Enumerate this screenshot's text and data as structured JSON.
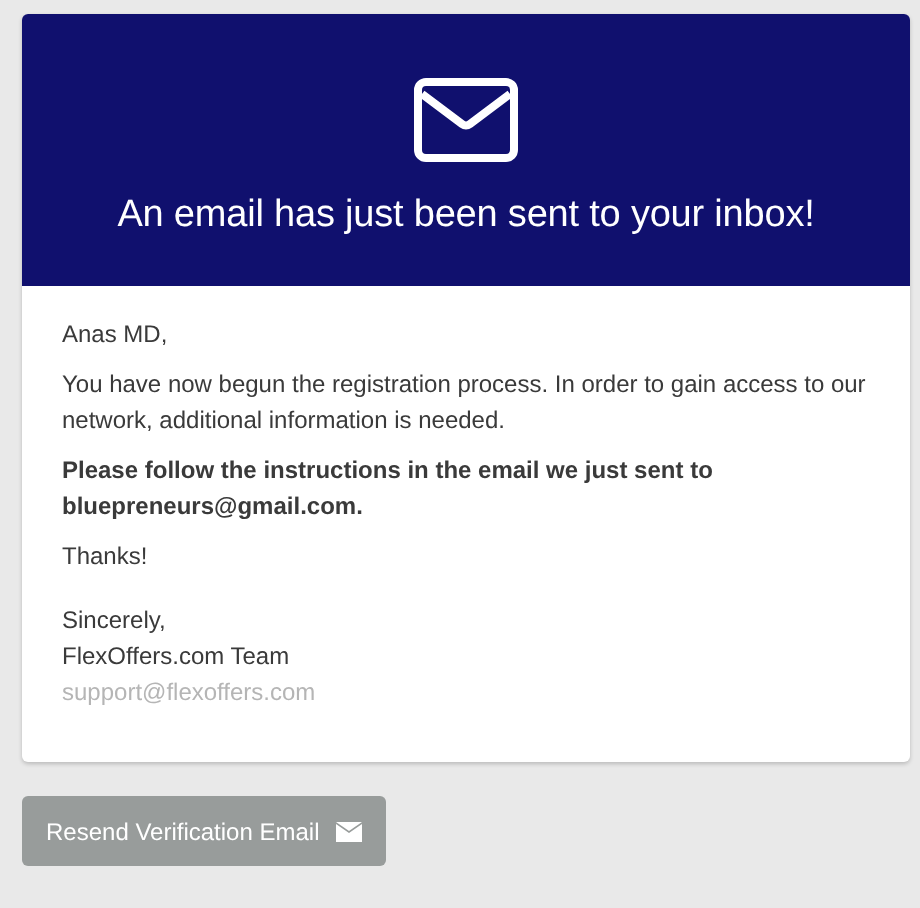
{
  "header": {
    "title": "An email has just been sent to your inbox!"
  },
  "message": {
    "greeting": "Anas MD,",
    "intro": "You have now begun the registration process. In order to gain access to our network, additional information is needed.",
    "instruction": "Please follow the instructions in the email we just sent to bluepreneurs@gmail.com.",
    "thanks": "Thanks!",
    "closing": "Sincerely,",
    "signature": "FlexOffers.com Team",
    "support_email": "support@flexoffers.com"
  },
  "button": {
    "label": "Resend Verification Email"
  }
}
